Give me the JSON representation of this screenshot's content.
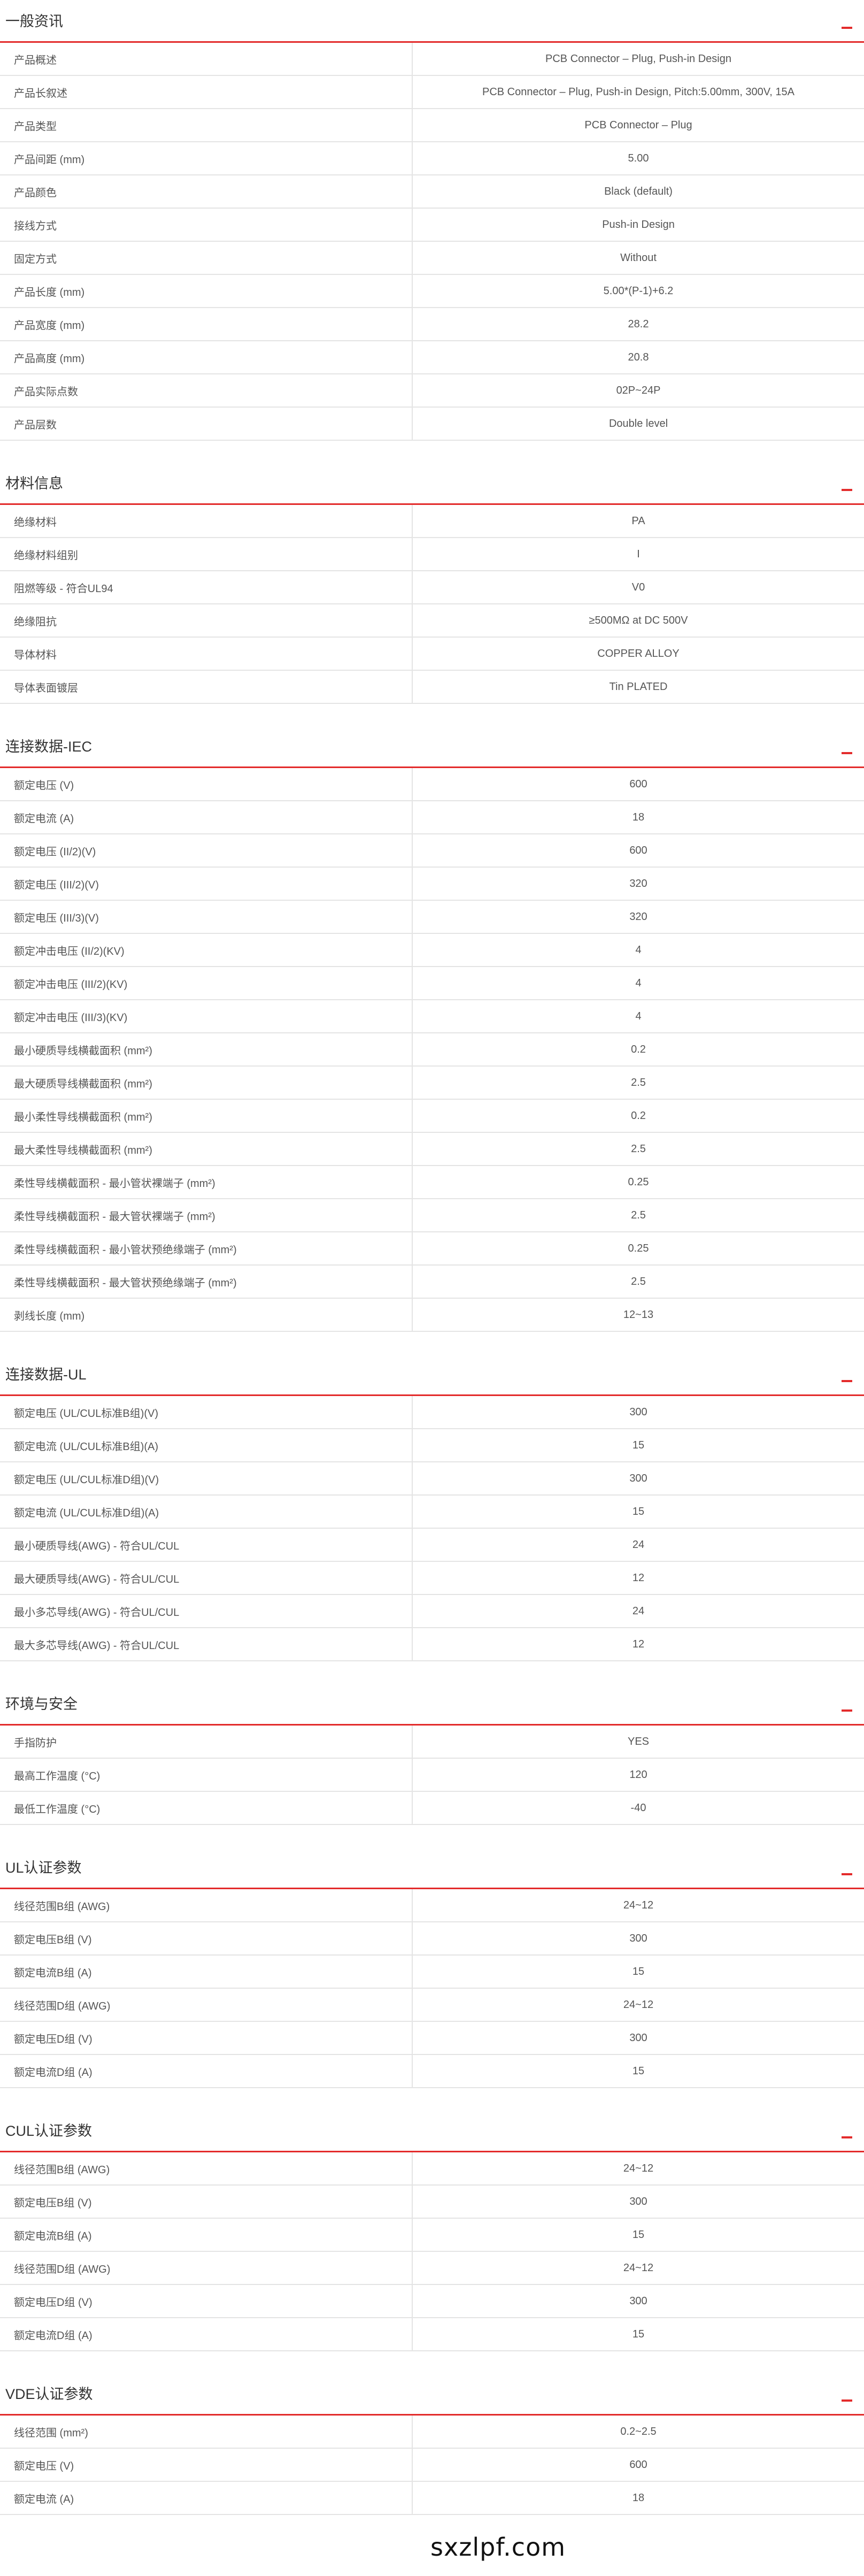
{
  "sections": [
    {
      "title": "一般资讯",
      "rows": [
        {
          "label": "产品概述",
          "value": "PCB Connector – Plug, Push-in Design"
        },
        {
          "label": "产品长叙述",
          "value": "PCB Connector – Plug, Push-in Design, Pitch:5.00mm, 300V, 15A"
        },
        {
          "label": "产品类型",
          "value": "PCB Connector – Plug"
        },
        {
          "label": "产品间距 (mm)",
          "value": "5.00"
        },
        {
          "label": "产品颜色",
          "value": "Black (default)"
        },
        {
          "label": "接线方式",
          "value": "Push-in Design"
        },
        {
          "label": "固定方式",
          "value": "Without"
        },
        {
          "label": "产品长度 (mm)",
          "value": "5.00*(P-1)+6.2"
        },
        {
          "label": "产品宽度 (mm)",
          "value": "28.2"
        },
        {
          "label": "产品高度 (mm)",
          "value": "20.8"
        },
        {
          "label": "产品实际点数",
          "value": "02P~24P"
        },
        {
          "label": "产品层数",
          "value": "Double level"
        }
      ]
    },
    {
      "title": "材料信息",
      "rows": [
        {
          "label": "绝缘材料",
          "value": "PA"
        },
        {
          "label": "绝缘材料组别",
          "value": "I"
        },
        {
          "label": "阻燃等级 - 符合UL94",
          "value": "V0"
        },
        {
          "label": "绝缘阻抗",
          "value": "≥500MΩ at DC 500V"
        },
        {
          "label": "导体材料",
          "value": "COPPER ALLOY"
        },
        {
          "label": "导体表面镀层",
          "value": "Tin PLATED"
        }
      ]
    },
    {
      "title": "连接数据-IEC",
      "rows": [
        {
          "label": "额定电压 (V)",
          "value": "600"
        },
        {
          "label": "额定电流 (A)",
          "value": "18"
        },
        {
          "label": "额定电压 (II/2)(V)",
          "value": "600"
        },
        {
          "label": "额定电压 (III/2)(V)",
          "value": "320"
        },
        {
          "label": "额定电压 (III/3)(V)",
          "value": "320"
        },
        {
          "label": "额定冲击电压 (II/2)(KV)",
          "value": "4"
        },
        {
          "label": "额定冲击电压 (III/2)(KV)",
          "value": "4"
        },
        {
          "label": "额定冲击电压 (III/3)(KV)",
          "value": "4"
        },
        {
          "label": "最小硬质导线横截面积 (mm²)",
          "value": "0.2"
        },
        {
          "label": "最大硬质导线横截面积 (mm²)",
          "value": "2.5"
        },
        {
          "label": "最小柔性导线横截面积 (mm²)",
          "value": "0.2"
        },
        {
          "label": "最大柔性导线横截面积 (mm²)",
          "value": "2.5"
        },
        {
          "label": "柔性导线横截面积 - 最小管状裸端子 (mm²)",
          "value": "0.25"
        },
        {
          "label": "柔性导线横截面积 - 最大管状裸端子 (mm²)",
          "value": "2.5"
        },
        {
          "label": "柔性导线横截面积 - 最小管状预绝缘端子 (mm²)",
          "value": "0.25"
        },
        {
          "label": "柔性导线横截面积 - 最大管状预绝缘端子 (mm²)",
          "value": "2.5"
        },
        {
          "label": "剥线长度 (mm)",
          "value": "12~13"
        }
      ]
    },
    {
      "title": "连接数据-UL",
      "rows": [
        {
          "label": "额定电压 (UL/CUL标准B组)(V)",
          "value": "300"
        },
        {
          "label": "额定电流 (UL/CUL标准B组)(A)",
          "value": "15"
        },
        {
          "label": "额定电压 (UL/CUL标准D组)(V)",
          "value": "300"
        },
        {
          "label": "额定电流 (UL/CUL标准D组)(A)",
          "value": "15"
        },
        {
          "label": "最小硬质导线(AWG) - 符合UL/CUL",
          "value": "24"
        },
        {
          "label": "最大硬质导线(AWG) - 符合UL/CUL",
          "value": "12"
        },
        {
          "label": "最小多芯导线(AWG) - 符合UL/CUL",
          "value": "24"
        },
        {
          "label": "最大多芯导线(AWG) - 符合UL/CUL",
          "value": "12"
        }
      ]
    },
    {
      "title": "环境与安全",
      "rows": [
        {
          "label": "手指防护",
          "value": "YES"
        },
        {
          "label": "最高工作温度 (°C)",
          "value": "120"
        },
        {
          "label": "最低工作温度 (°C)",
          "value": "-40"
        }
      ]
    },
    {
      "title": "UL认证参数",
      "rows": [
        {
          "label": "线径范围B组 (AWG)",
          "value": "24~12"
        },
        {
          "label": "额定电压B组 (V)",
          "value": "300"
        },
        {
          "label": "额定电流B组 (A)",
          "value": "15"
        },
        {
          "label": "线径范围D组 (AWG)",
          "value": "24~12"
        },
        {
          "label": "额定电压D组 (V)",
          "value": "300"
        },
        {
          "label": "额定电流D组 (A)",
          "value": "15"
        }
      ]
    },
    {
      "title": "CUL认证参数",
      "rows": [
        {
          "label": "线径范围B组 (AWG)",
          "value": "24~12"
        },
        {
          "label": "额定电压B组 (V)",
          "value": "300"
        },
        {
          "label": "额定电流B组 (A)",
          "value": "15"
        },
        {
          "label": "线径范围D组 (AWG)",
          "value": "24~12"
        },
        {
          "label": "额定电压D组 (V)",
          "value": "300"
        },
        {
          "label": "额定电流D组 (A)",
          "value": "15"
        }
      ]
    },
    {
      "title": "VDE认证参数",
      "rows": [
        {
          "label": "线径范围 (mm²)",
          "value": "0.2~2.5"
        },
        {
          "label": "额定电压 (V)",
          "value": "600"
        },
        {
          "label": "额定电流 (A)",
          "value": "18"
        }
      ]
    }
  ],
  "watermark": "sxzlpf.com",
  "colors": {
    "accent": "#e32b2b",
    "border": "#e4e4e4",
    "text": "#555555"
  }
}
